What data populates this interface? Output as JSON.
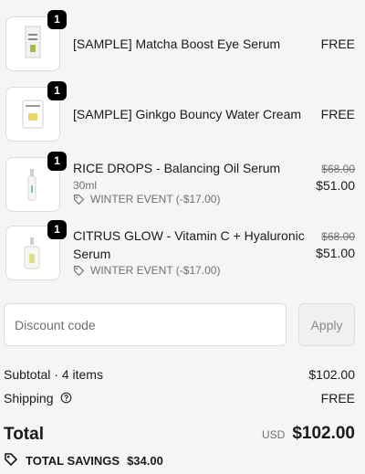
{
  "items": [
    {
      "quantity": "1",
      "name": "[SAMPLE] Matcha Boost Eye Serum",
      "price": "FREE"
    },
    {
      "quantity": "1",
      "name": "[SAMPLE] Ginkgo Bouncy Water Cream",
      "price": "FREE"
    },
    {
      "quantity": "1",
      "name": "RICE DROPS - Balancing Oil Serum",
      "variant": "30ml",
      "discount": "WINTER EVENT (-$17.00)",
      "original_price": "$68.00",
      "price": "$51.00"
    },
    {
      "quantity": "1",
      "name_line1": "CITRUS GLOW - Vitamin C + Hyaluronic",
      "name_line2": "Serum",
      "discount": "WINTER EVENT (-$17.00)",
      "original_price": "$68.00",
      "price": "$51.00"
    }
  ],
  "discount_field": {
    "placeholder": "Discount code",
    "value": ""
  },
  "apply_label": "Apply",
  "subtotal": {
    "label": "Subtotal · 4 items",
    "value": "$102.00"
  },
  "shipping": {
    "label": "Shipping",
    "value": "FREE"
  },
  "total": {
    "label": "Total",
    "currency": "USD",
    "value": "$102.00"
  },
  "savings": {
    "label": "TOTAL SAVINGS",
    "value": "$34.00"
  },
  "icons": [
    "tag-icon",
    "help-circle-icon"
  ]
}
